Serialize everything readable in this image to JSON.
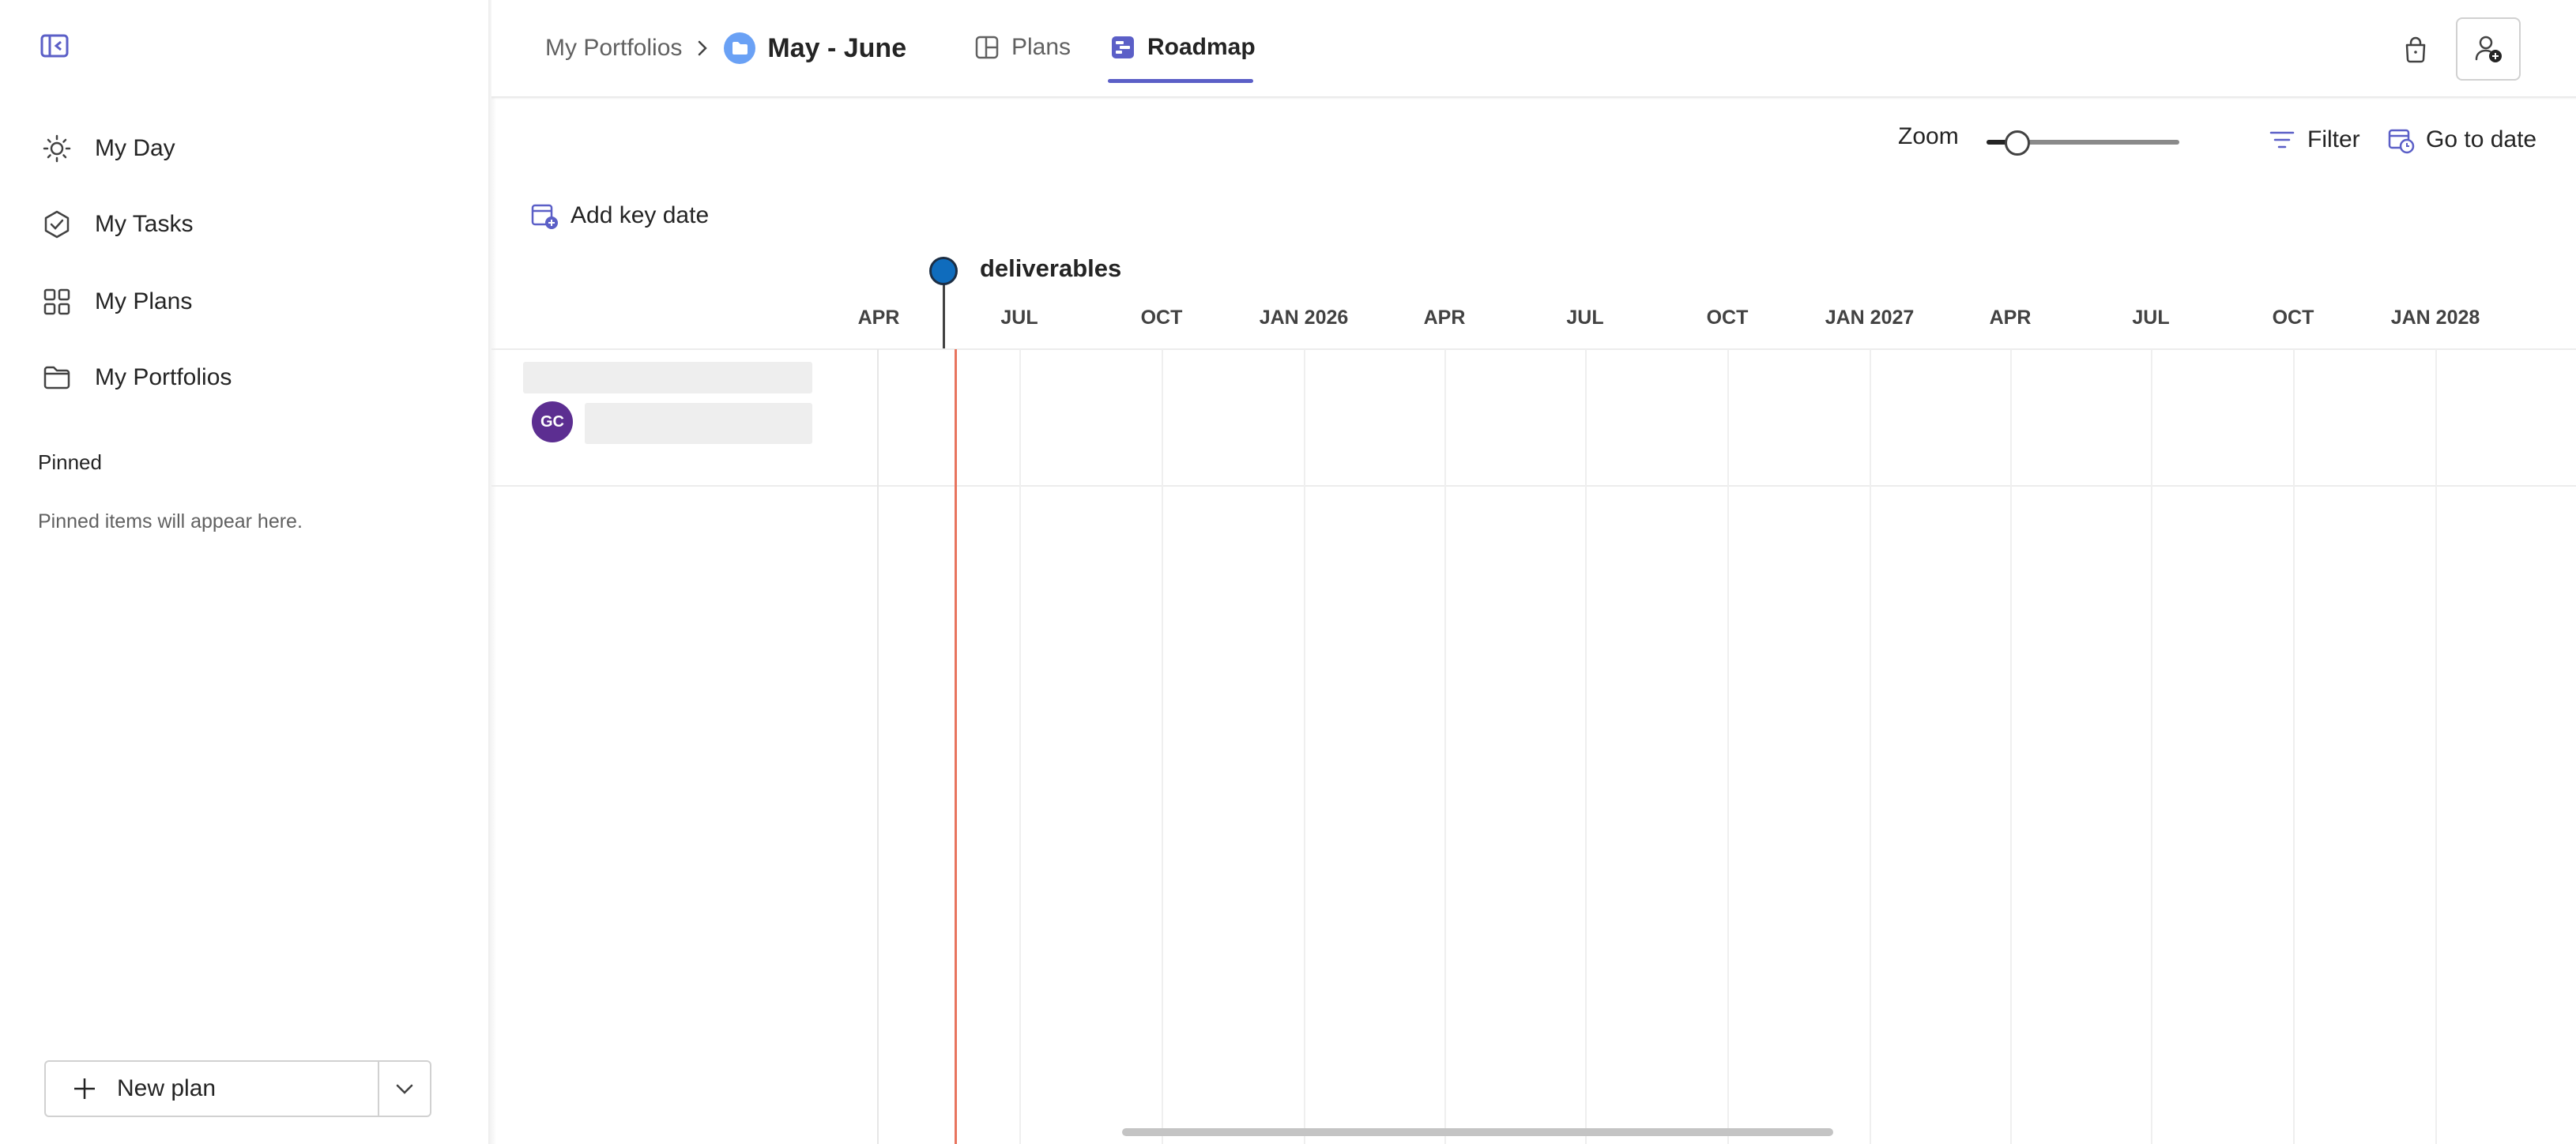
{
  "sidebar": {
    "items": [
      {
        "label": "My Day",
        "icon": "sun-icon"
      },
      {
        "label": "My Tasks",
        "icon": "task-check-icon"
      },
      {
        "label": "My Plans",
        "icon": "grid-icon"
      },
      {
        "label": "My Portfolios",
        "icon": "folder-icon"
      }
    ],
    "pinned_title": "Pinned",
    "pinned_empty": "Pinned items will appear here.",
    "new_plan_label": "New plan"
  },
  "header": {
    "breadcrumb_root": "My Portfolios",
    "portfolio_title": "May - June",
    "tabs": [
      {
        "label": "Plans",
        "active": false
      },
      {
        "label": "Roadmap",
        "active": true
      }
    ]
  },
  "toolbar": {
    "zoom_label": "Zoom",
    "zoom_level": 0.16,
    "filter_label": "Filter",
    "go_to_date_label": "Go to date",
    "add_key_date_label": "Add key date"
  },
  "timeline": {
    "key_date_label": "deliverables",
    "ticks": [
      "APR",
      "JUL",
      "OCT",
      "JAN 2026",
      "APR",
      "JUL",
      "OCT",
      "JAN 2027",
      "APR",
      "JUL",
      "OCT",
      "JAN 2028"
    ],
    "row": {
      "avatar_initials": "GC"
    }
  },
  "colors": {
    "accent": "#5b5fc7",
    "today_line": "#e8745e",
    "key_date": "#0f6cbd",
    "avatar": "#5c2e91"
  }
}
